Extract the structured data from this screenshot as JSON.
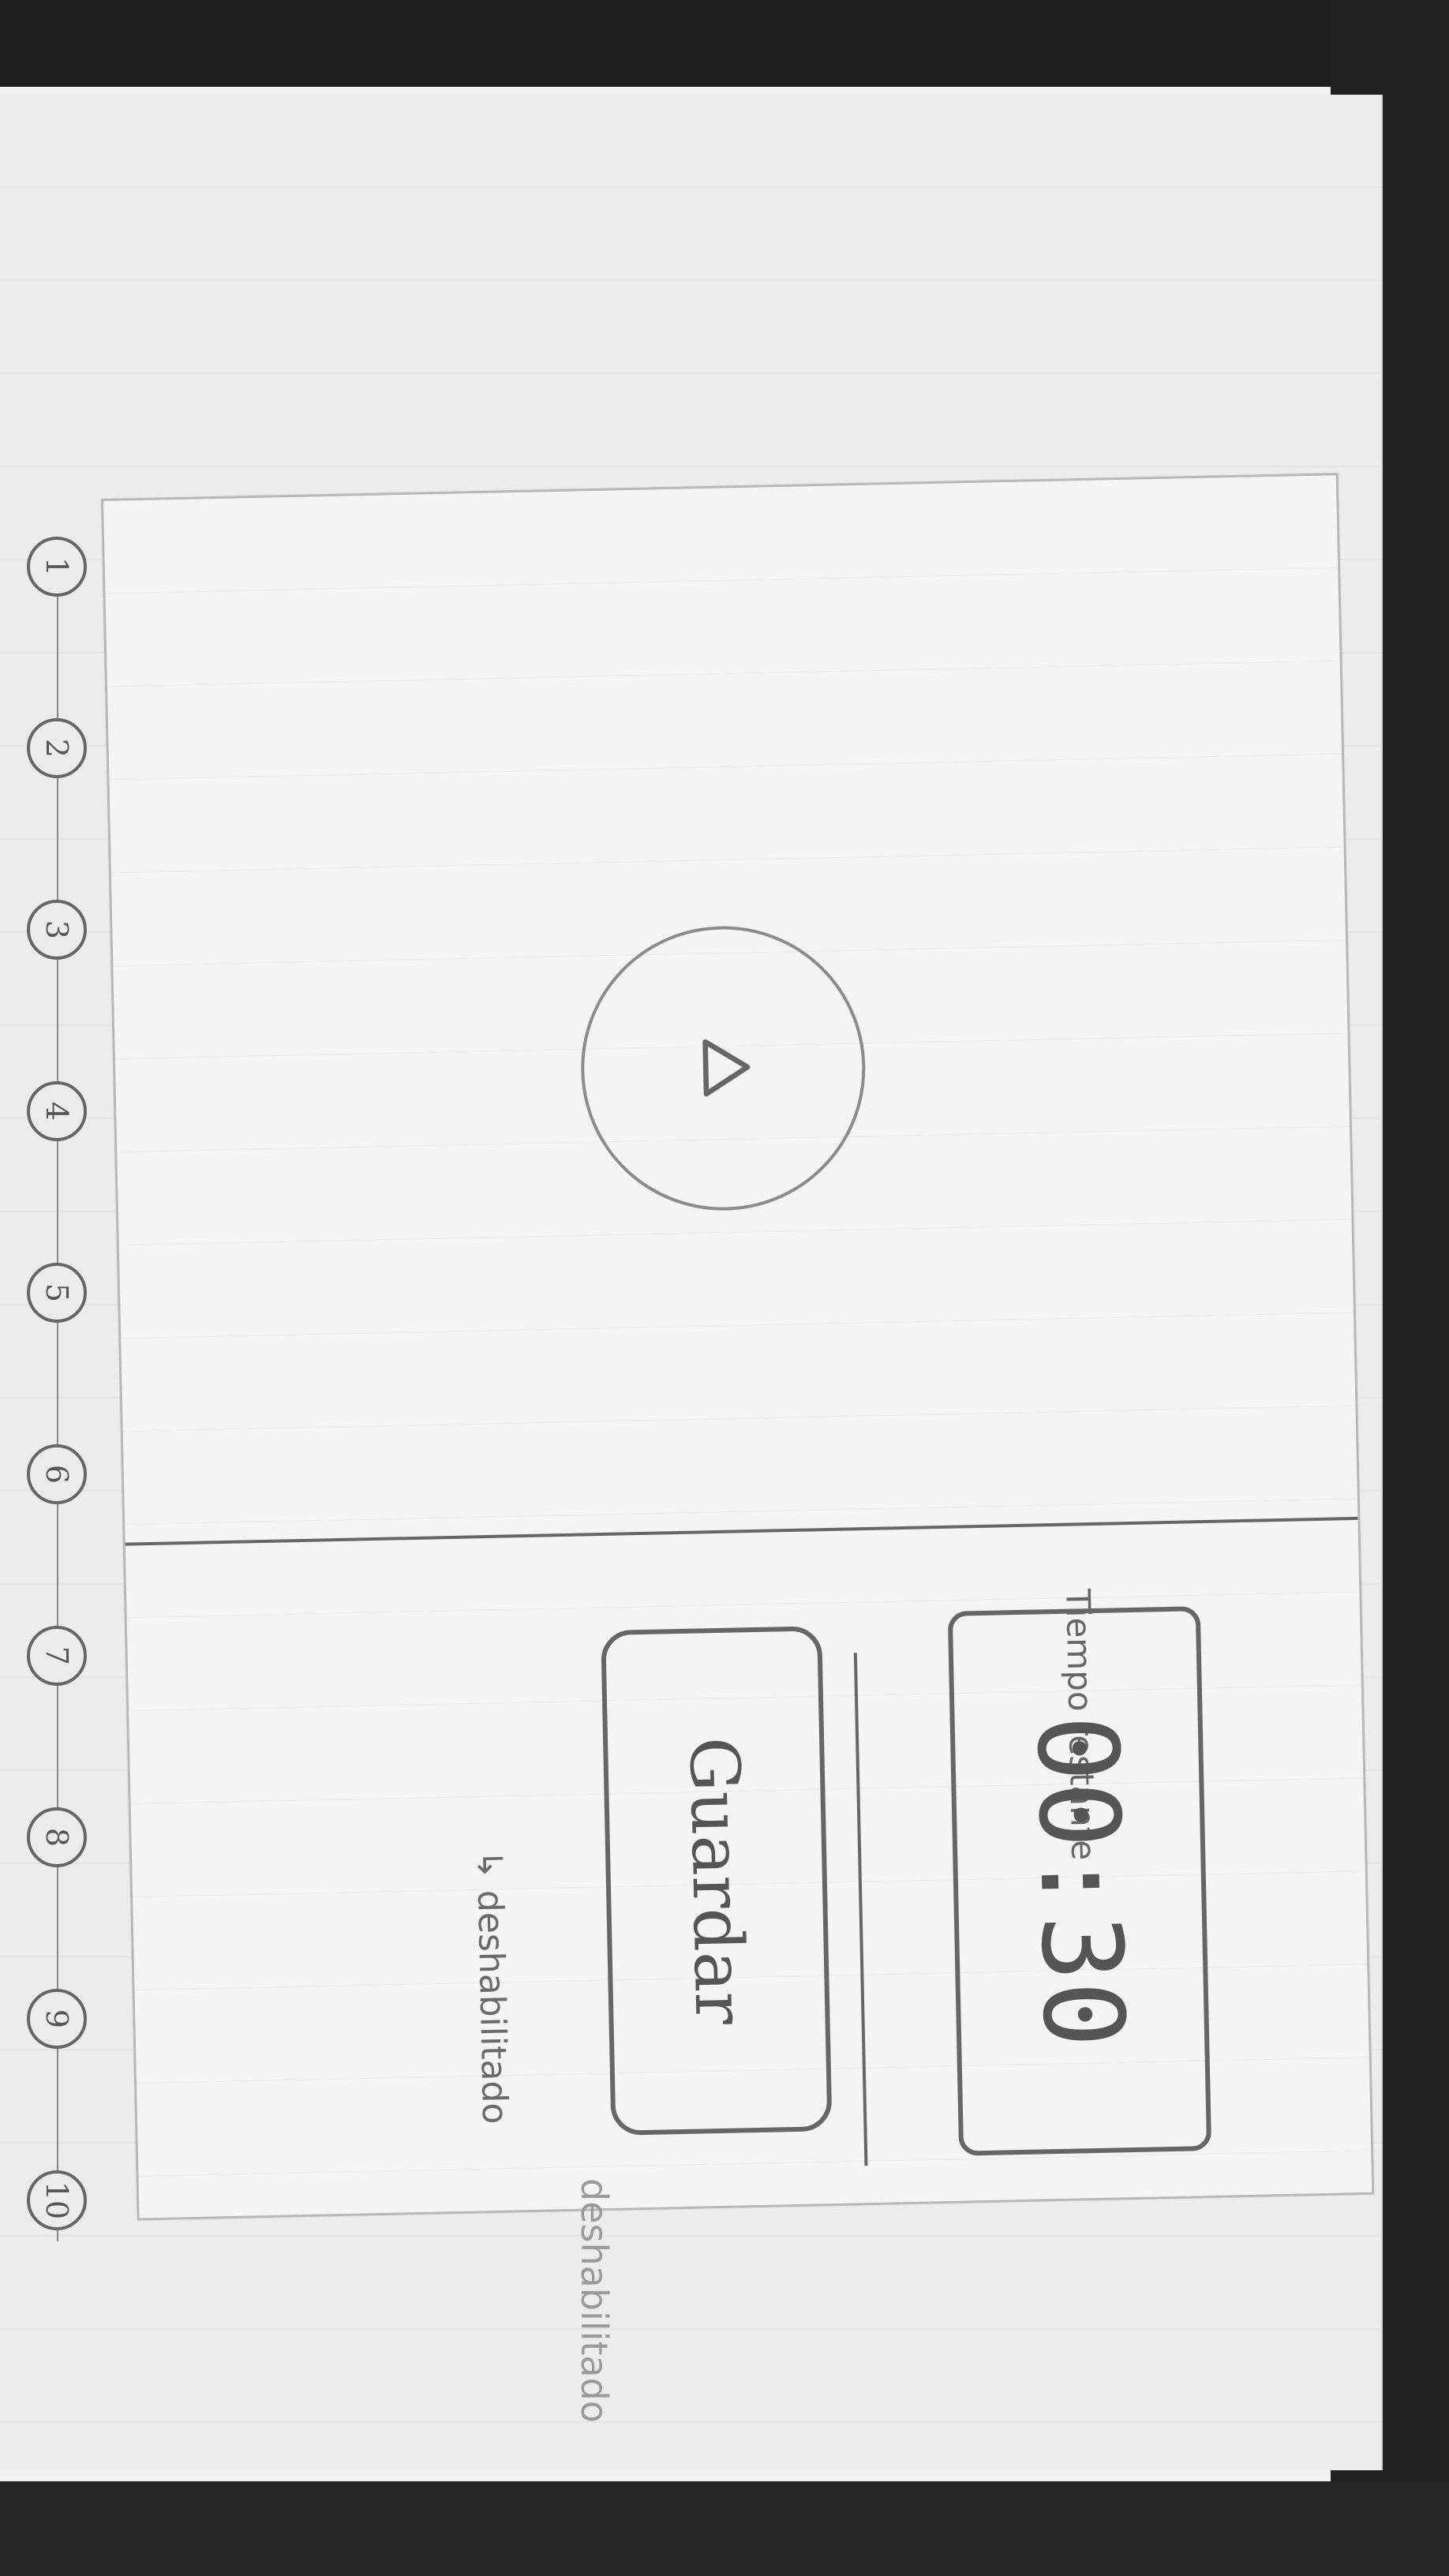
{
  "stepper": {
    "steps": [
      "1",
      "2",
      "3",
      "4",
      "5",
      "6",
      "7",
      "8",
      "9",
      "10"
    ]
  },
  "main": {
    "play_icon": "play-icon"
  },
  "footer": {
    "timer_label": "Tiempo restante",
    "timer_value": "00:30",
    "save_label": "Guardar",
    "save_note": "↳ deshabilitado"
  },
  "annotations": {
    "outer_note": "deshabilitado"
  }
}
